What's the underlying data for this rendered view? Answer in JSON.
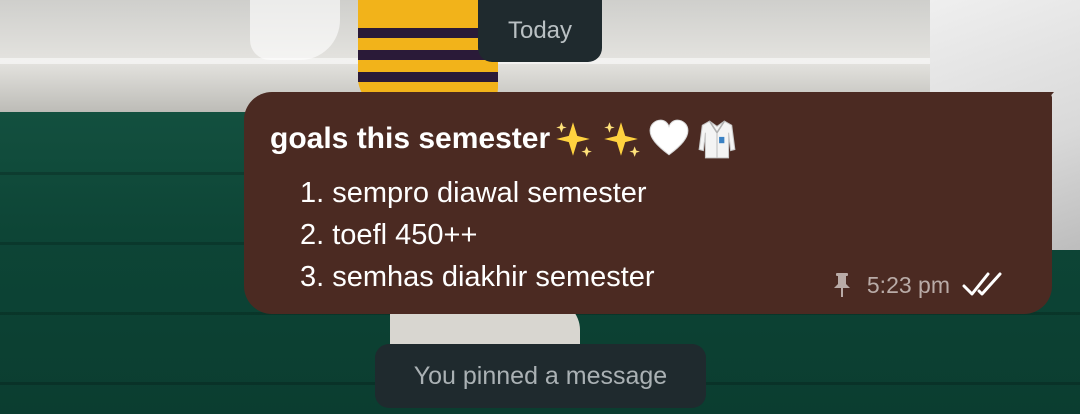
{
  "date_divider": "Today",
  "message": {
    "title": "goals this semester",
    "title_emojis": [
      "sparkles-icon",
      "sparkles-icon",
      "white-heart-icon",
      "lab-coat-icon"
    ],
    "items": [
      {
        "number": "1.",
        "text": "sempro diawal semester"
      },
      {
        "number": "2.",
        "text": "toefl 450++"
      },
      {
        "number": "3.",
        "text": "semhas diakhir semester"
      }
    ],
    "time": "5:23 pm",
    "pinned": true,
    "status": "read",
    "bubble_color": "#4b2a22"
  },
  "system_message": "You pinned a message",
  "colors": {
    "pill_bg": "#1f2a2e",
    "tick_read": "#ffffff"
  }
}
